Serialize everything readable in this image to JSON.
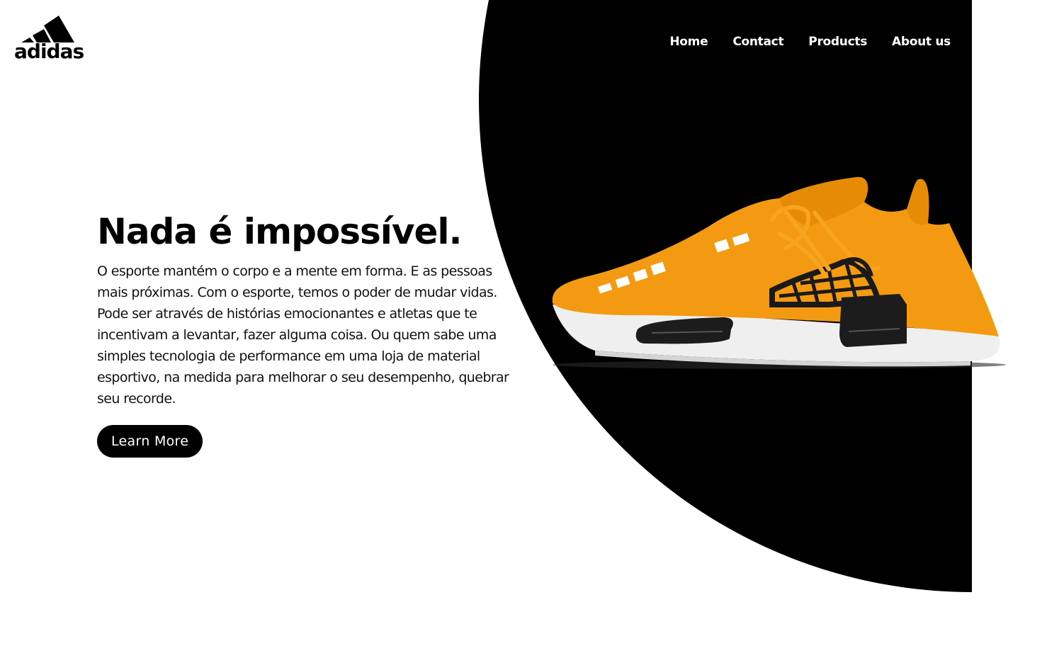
{
  "brand": {
    "name": "adidas",
    "logo_icon": "adidas-three-bars-icon",
    "color": "#000000"
  },
  "nav": {
    "items": [
      {
        "label": "Home"
      },
      {
        "label": "Contact"
      },
      {
        "label": "Products"
      },
      {
        "label": "About us"
      }
    ]
  },
  "hero": {
    "title": "Nada é impossível.",
    "description": "O esporte mantém o corpo e a mente em forma. E as pessoas mais próximas. Com o esporte, temos o poder de mudar vidas. Pode ser através de histórias emocionantes e atletas que te incentivam a levantar, fazer alguma coisa. Ou quem sabe uma simples tecnologia de performance em uma loja de material esportivo, na medida para melhorar o seu desempenho, quebrar seu recorde.",
    "cta_label": "Learn More"
  },
  "product_image": {
    "icon": "orange-sneaker-image",
    "accent_color": "#f39a12"
  },
  "colors": {
    "background": "#ffffff",
    "backdrop": "#000000",
    "text": "#000000"
  }
}
